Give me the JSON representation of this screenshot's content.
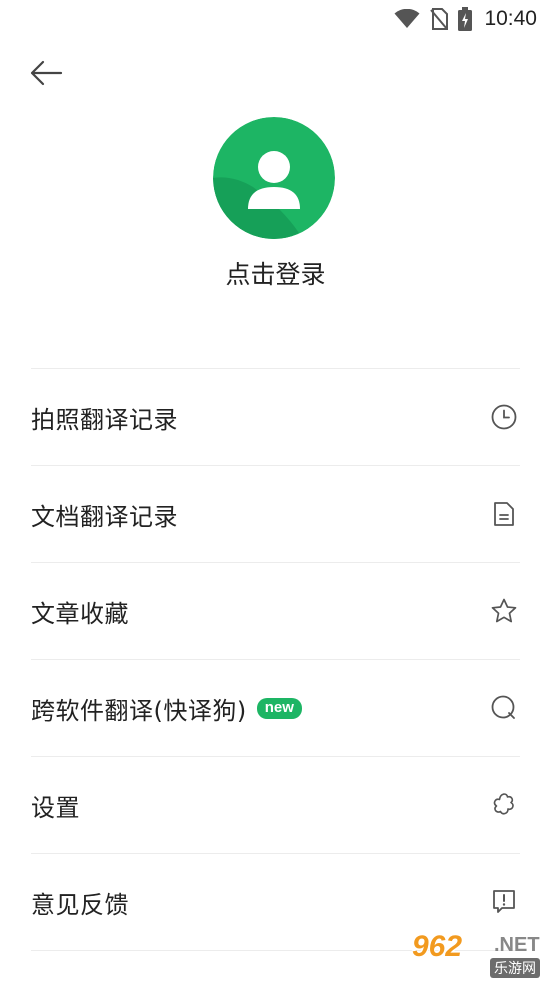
{
  "status_bar": {
    "time": "10:40",
    "icons": [
      "wifi-icon",
      "no-sim-icon",
      "battery-charging-icon"
    ]
  },
  "header": {
    "back_icon": "arrow-left-icon"
  },
  "profile": {
    "avatar_icon": "user-icon",
    "login_label": "点击登录",
    "avatar_color": "#1db564"
  },
  "menu": {
    "items": [
      {
        "label": "拍照翻译记录",
        "icon": "clock-icon"
      },
      {
        "label": "文档翻译记录",
        "icon": "document-icon"
      },
      {
        "label": "文章收藏",
        "icon": "star-icon"
      },
      {
        "label": "跨软件翻译(快译狗)",
        "icon": "search-icon",
        "badge": "new"
      },
      {
        "label": "设置",
        "icon": "gear-icon"
      },
      {
        "label": "意见反馈",
        "icon": "feedback-icon"
      }
    ]
  },
  "watermark": {
    "number": "962",
    "domain": ".NET",
    "subtitle": "乐游网"
  },
  "colors": {
    "accent": "#1db564",
    "divider": "#ececec",
    "text": "#222222",
    "icon": "#555555"
  }
}
